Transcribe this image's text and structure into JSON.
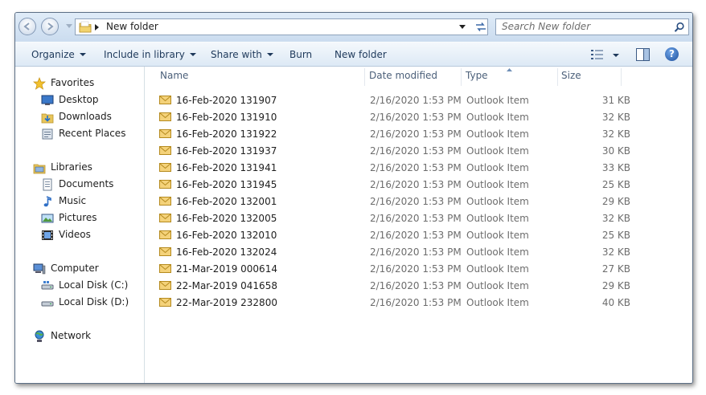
{
  "address": {
    "path": "New folder",
    "search_placeholder": "Search New folder"
  },
  "toolbar": {
    "organize": "Organize",
    "include_in_library": "Include in library",
    "share_with": "Share with",
    "burn": "Burn",
    "new_folder": "New folder"
  },
  "nav": {
    "favorites": "Favorites",
    "desktop": "Desktop",
    "downloads": "Downloads",
    "recent_places": "Recent Places",
    "libraries": "Libraries",
    "documents": "Documents",
    "music": "Music",
    "pictures": "Pictures",
    "videos": "Videos",
    "computer": "Computer",
    "local_disk_c": "Local Disk (C:)",
    "local_disk_d": "Local Disk (D:)",
    "network": "Network"
  },
  "columns": {
    "name": "Name",
    "date_modified": "Date modified",
    "type": "Type",
    "size": "Size"
  },
  "files": [
    {
      "name": "16-Feb-2020 131907",
      "date": "2/16/2020 1:53 PM",
      "type": "Outlook Item",
      "size": "31 KB"
    },
    {
      "name": "16-Feb-2020 131910",
      "date": "2/16/2020 1:53 PM",
      "type": "Outlook Item",
      "size": "32 KB"
    },
    {
      "name": "16-Feb-2020 131922",
      "date": "2/16/2020 1:53 PM",
      "type": "Outlook Item",
      "size": "32 KB"
    },
    {
      "name": "16-Feb-2020 131937",
      "date": "2/16/2020 1:53 PM",
      "type": "Outlook Item",
      "size": "30 KB"
    },
    {
      "name": "16-Feb-2020 131941",
      "date": "2/16/2020 1:53 PM",
      "type": "Outlook Item",
      "size": "33 KB"
    },
    {
      "name": "16-Feb-2020 131945",
      "date": "2/16/2020 1:53 PM",
      "type": "Outlook Item",
      "size": "25 KB"
    },
    {
      "name": "16-Feb-2020 132001",
      "date": "2/16/2020 1:53 PM",
      "type": "Outlook Item",
      "size": "29 KB"
    },
    {
      "name": "16-Feb-2020 132005",
      "date": "2/16/2020 1:53 PM",
      "type": "Outlook Item",
      "size": "32 KB"
    },
    {
      "name": "16-Feb-2020 132010",
      "date": "2/16/2020 1:53 PM",
      "type": "Outlook Item",
      "size": "25 KB"
    },
    {
      "name": "16-Feb-2020 132024",
      "date": "2/16/2020 1:53 PM",
      "type": "Outlook Item",
      "size": "32 KB"
    },
    {
      "name": "21-Mar-2019 000614",
      "date": "2/16/2020 1:53 PM",
      "type": "Outlook Item",
      "size": "27 KB"
    },
    {
      "name": "22-Mar-2019 041658",
      "date": "2/16/2020 1:53 PM",
      "type": "Outlook Item",
      "size": "29 KB"
    },
    {
      "name": "22-Mar-2019 232800",
      "date": "2/16/2020 1:53 PM",
      "type": "Outlook Item",
      "size": "40 KB"
    }
  ]
}
